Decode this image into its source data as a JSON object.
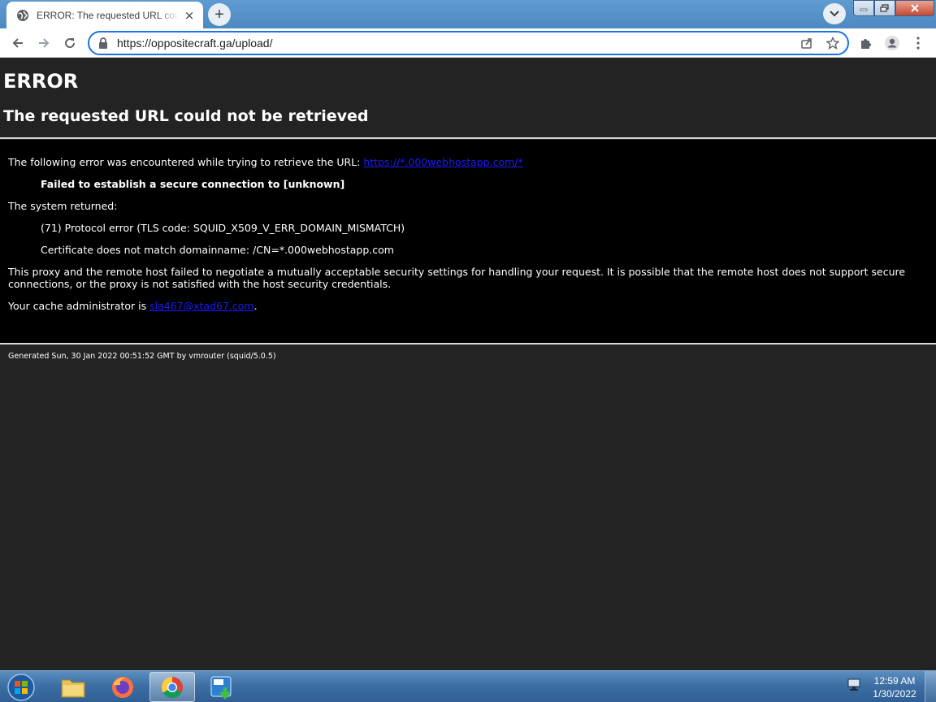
{
  "browser": {
    "tab_title": "ERROR: The requested URL could not be retrieved",
    "new_tab_symbol": "+",
    "close_symbol": "×",
    "address": "https://oppositecraft.ga/upload/"
  },
  "page": {
    "heading": "ERROR",
    "subheading": "The requested URL could not be retrieved",
    "intro_text": "The following error was encountered while trying to retrieve the URL: ",
    "intro_link": "https://*.000webhostapp.com/*",
    "error_title": "Failed to establish a secure connection to [unknown]",
    "system_returned": "The system returned:",
    "protocol_error": "(71) Protocol error (TLS code: SQUID_X509_V_ERR_DOMAIN_MISMATCH)",
    "cert_mismatch": "Certificate does not match domainname: /CN=*.000webhostapp.com",
    "explanation_line1": "This proxy and the remote host failed to negotiate a mutually acceptable security settings for handling your request. It is possible that the remote host does not support secure",
    "explanation_line2": "connections, or the proxy is not satisfied with the host security credentials.",
    "admin_text": "Your cache administrator is ",
    "admin_link": "sla467@xtad67.com",
    "admin_end": ".",
    "footer": "Generated Sun, 30 Jan 2022 00:51:52 GMT by vmrouter (squid/5.0.5)"
  },
  "taskbar": {
    "items": [
      "windows-explorer",
      "firefox",
      "chrome",
      "iobit-uninstaller"
    ],
    "time": "12:59 AM",
    "date": "1/30/2022"
  },
  "colors": {
    "page_bg": "#232323",
    "error_box_bg": "#000000",
    "link": "#1a1aff",
    "omnibox_focus": "#1a73e8"
  }
}
